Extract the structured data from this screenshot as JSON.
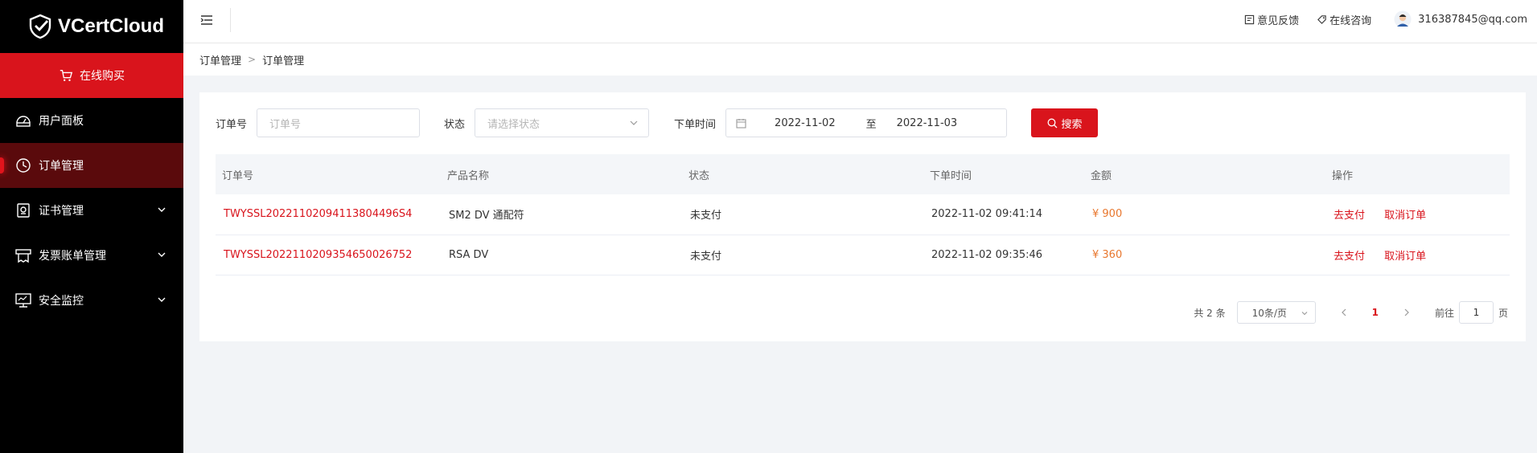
{
  "brand": {
    "name": "VCertCloud"
  },
  "sidebar": {
    "buy_label": "在线购买",
    "items": [
      {
        "label": "用户面板",
        "icon": "dashboard-icon"
      },
      {
        "label": "订单管理",
        "icon": "order-icon",
        "active": true
      },
      {
        "label": "证书管理",
        "icon": "certificate-icon",
        "expandable": true
      },
      {
        "label": "发票账单管理",
        "icon": "invoice-icon",
        "expandable": true
      },
      {
        "label": "安全监控",
        "icon": "monitor-icon",
        "expandable": true
      }
    ]
  },
  "header": {
    "feedback_label": "意见反馈",
    "consult_label": "在线咨询",
    "user_email": "316387845@qq.com"
  },
  "breadcrumb": {
    "level1": "订单管理",
    "level2": "订单管理"
  },
  "filters": {
    "order_label": "订单号",
    "order_placeholder": "订单号",
    "status_label": "状态",
    "status_placeholder": "请选择状态",
    "time_label": "下单时间",
    "date_start": "2022-11-02",
    "date_sep": "至",
    "date_end": "2022-11-03",
    "search_label": "搜索"
  },
  "table": {
    "headers": [
      "订单号",
      "产品名称",
      "状态",
      "下单时间",
      "金额",
      "操作"
    ],
    "rows": [
      {
        "order_no": "TWYSSL20221102094113804496S4",
        "product": "SM2 DV 通配符",
        "status": "未支付",
        "time": "2022-11-02 09:41:14",
        "amount": "¥ 900",
        "pay": "去支付",
        "cancel": "取消订单"
      },
      {
        "order_no": "TWYSSL202211020935465002675​2",
        "product": "RSA DV",
        "status": "未支付",
        "time": "2022-11-02 09:35:46",
        "amount": "¥ 360",
        "pay": "去支付",
        "cancel": "取消订单"
      }
    ]
  },
  "pagination": {
    "total": "共 2 条",
    "page_size": "10条/页",
    "current_page": "1",
    "goto_prefix": "前往",
    "goto_value": "1",
    "goto_suffix": "页"
  },
  "colors": {
    "accent": "#d9141c",
    "amount": "#e8772e",
    "sidebar_bg": "#000000"
  }
}
